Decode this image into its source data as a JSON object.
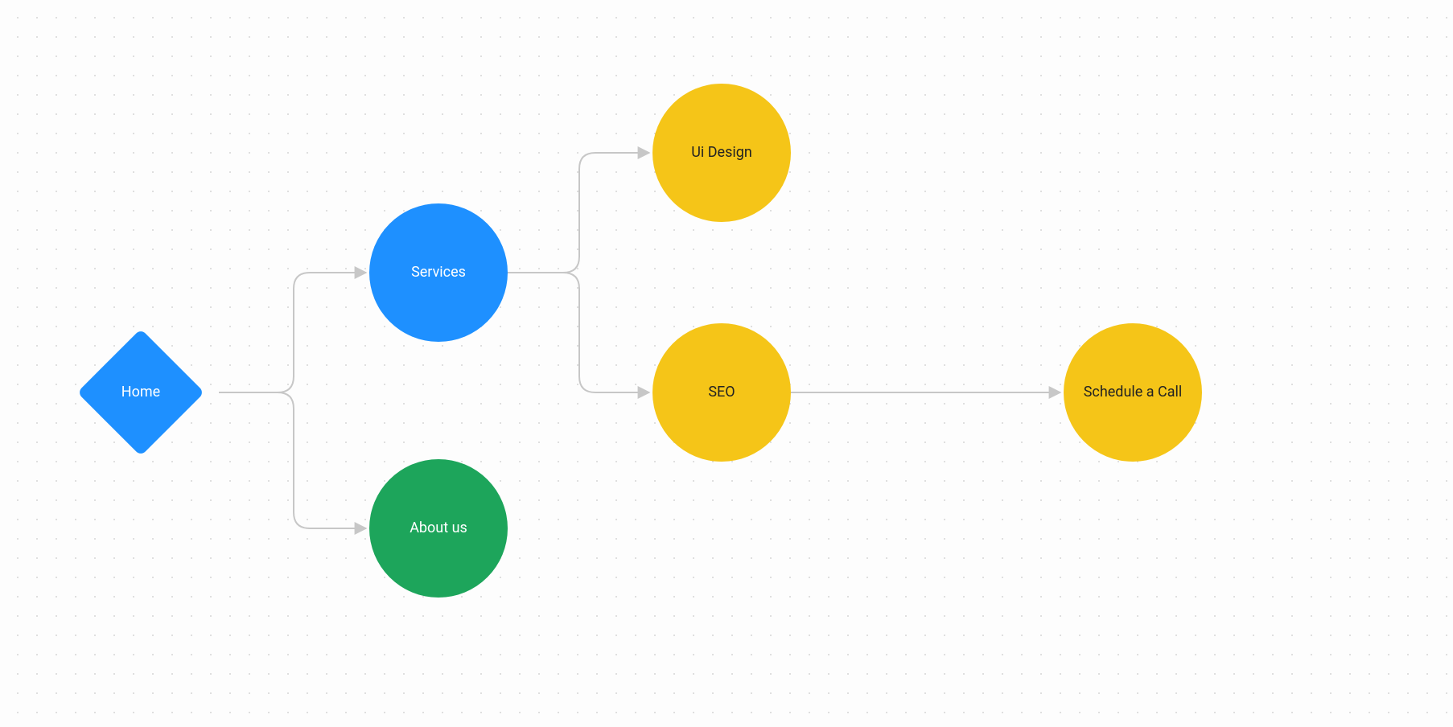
{
  "colors": {
    "blue": "#1E90FF",
    "green": "#1DA55B",
    "yellow": "#F5C518",
    "edge": "#C7C7C7",
    "text_dark": "#222222",
    "text_light": "#FFFFFF"
  },
  "nodes": {
    "home": {
      "label": "Home",
      "shape": "diamond",
      "color": "blue",
      "text": "light"
    },
    "services": {
      "label": "Services",
      "shape": "circle",
      "color": "blue",
      "text": "light"
    },
    "about_us": {
      "label": "About us",
      "shape": "circle",
      "color": "green",
      "text": "light"
    },
    "ui_design": {
      "label": "Ui Design",
      "shape": "circle",
      "color": "yellow",
      "text": "dark"
    },
    "seo": {
      "label": "SEO",
      "shape": "circle",
      "color": "yellow",
      "text": "dark"
    },
    "schedule": {
      "label": "Schedule a Call",
      "shape": "circle",
      "color": "yellow",
      "text": "dark"
    }
  },
  "edges": [
    {
      "from": "home",
      "to": "services"
    },
    {
      "from": "home",
      "to": "about_us"
    },
    {
      "from": "services",
      "to": "ui_design"
    },
    {
      "from": "services",
      "to": "seo"
    },
    {
      "from": "seo",
      "to": "schedule"
    }
  ]
}
